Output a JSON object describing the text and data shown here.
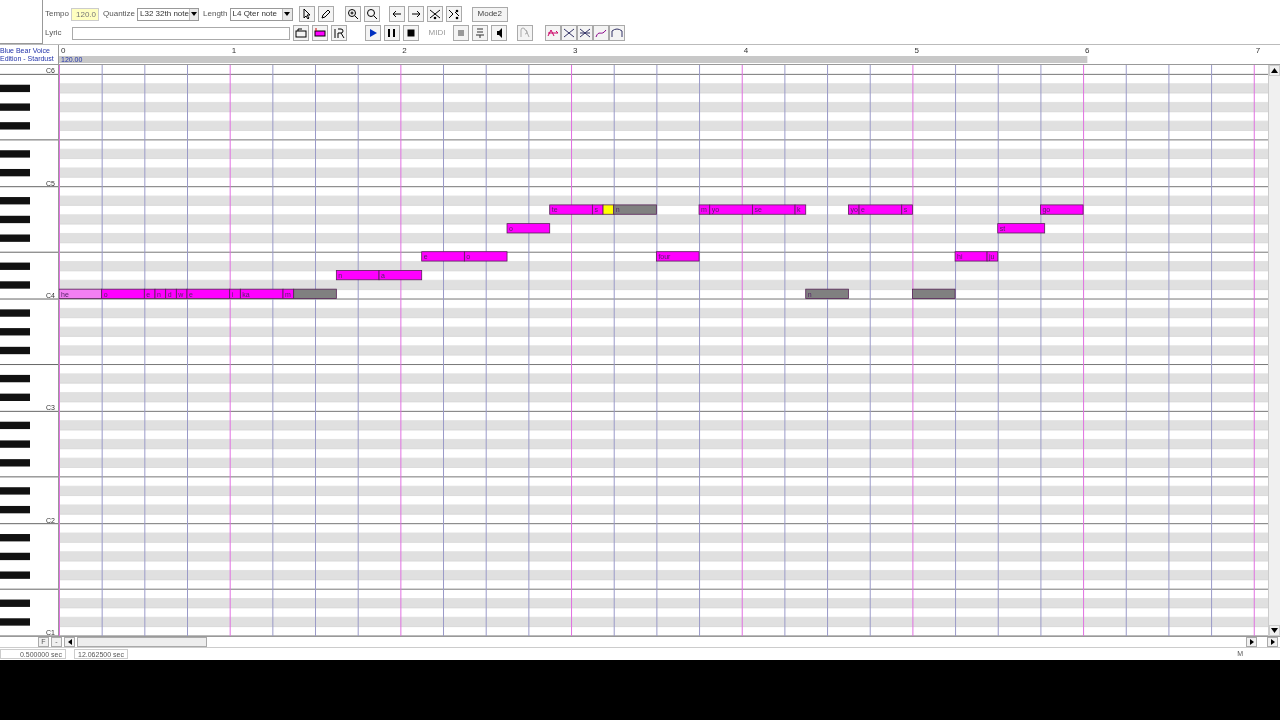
{
  "toolbar": {
    "tempo_label": "Tempo",
    "tempo": "120.0",
    "quantize_label": "Quantize",
    "quantize": "L32 32th note",
    "length_label": "Length",
    "length": "L4  Qter note",
    "mode_button": "Mode2",
    "lyric_label": "Lyric",
    "midi_label": "MIDI"
  },
  "track": {
    "name_lines": [
      "Blue Bear Voice",
      "Edition - Stardust"
    ]
  },
  "ruler": {
    "measures": [
      "0",
      "1",
      "2",
      "3",
      "4",
      "5",
      "6",
      "7"
    ],
    "tempo": "120.00"
  },
  "keyboard_labels": [
    "C6",
    "C5",
    "C4",
    "C3",
    "C2",
    "C1"
  ],
  "notes": [
    {
      "lyric": "te",
      "color": "#ff00ff"
    },
    {
      "lyric": "s",
      "color": "#ff00ff"
    },
    {
      "color": "#ffff00"
    },
    {
      "lyric": "n",
      "color": "#808080"
    },
    {
      "lyric": "m",
      "color": "#ff00ff"
    },
    {
      "lyric": "yo",
      "color": "#ff00ff"
    },
    {
      "lyric": "se",
      "color": "#ff00ff"
    },
    {
      "lyric": "k",
      "color": "#ff00ff"
    },
    {
      "lyric": "yo",
      "color": "#ff00ff"
    },
    {
      "lyric": "e",
      "color": "#ff00ff"
    },
    {
      "lyric": "s",
      "color": "#ff00ff"
    },
    {
      "lyric": "go",
      "color": "#ff00ff"
    },
    {
      "lyric": "o",
      "color": "#ff00ff"
    },
    {
      "lyric": "st",
      "color": "#ff00ff"
    },
    {
      "lyric": "e",
      "color": "#ff00ff"
    },
    {
      "lyric": "o",
      "color": "#ff00ff"
    },
    {
      "lyric": "four",
      "color": "#ff00ff"
    },
    {
      "lyric": "hi",
      "color": "#ff00ff"
    },
    {
      "lyric": "ju",
      "color": "#ff00ff"
    },
    {
      "lyric": "n",
      "color": "#ff00ff"
    },
    {
      "lyric": "a",
      "color": "#ff00ff"
    },
    {
      "lyric": "he",
      "color": "#f27ff2"
    },
    {
      "lyric": "o",
      "color": "#ff00ff"
    },
    {
      "lyric": "e",
      "color": "#ff00ff"
    },
    {
      "lyric": "n",
      "color": "#ff00ff"
    },
    {
      "lyric": "d",
      "color": "#ff00ff"
    },
    {
      "lyric": "w",
      "color": "#ff00ff"
    },
    {
      "lyric": "e",
      "color": "#ff00ff"
    },
    {
      "lyric": "i",
      "color": "#ff00ff"
    },
    {
      "lyric": "ka",
      "color": "#ff00ff"
    },
    {
      "lyric": "m",
      "color": "#ff00ff"
    },
    {
      "color": "#808080"
    },
    {
      "lyric": "n",
      "color": "#808080"
    },
    {
      "color": "#808080"
    }
  ],
  "hscroll": {
    "buttons": [
      "F",
      "-"
    ]
  },
  "status_bar": [
    "0.500000 sec",
    "12.062500 sec",
    "M"
  ]
}
